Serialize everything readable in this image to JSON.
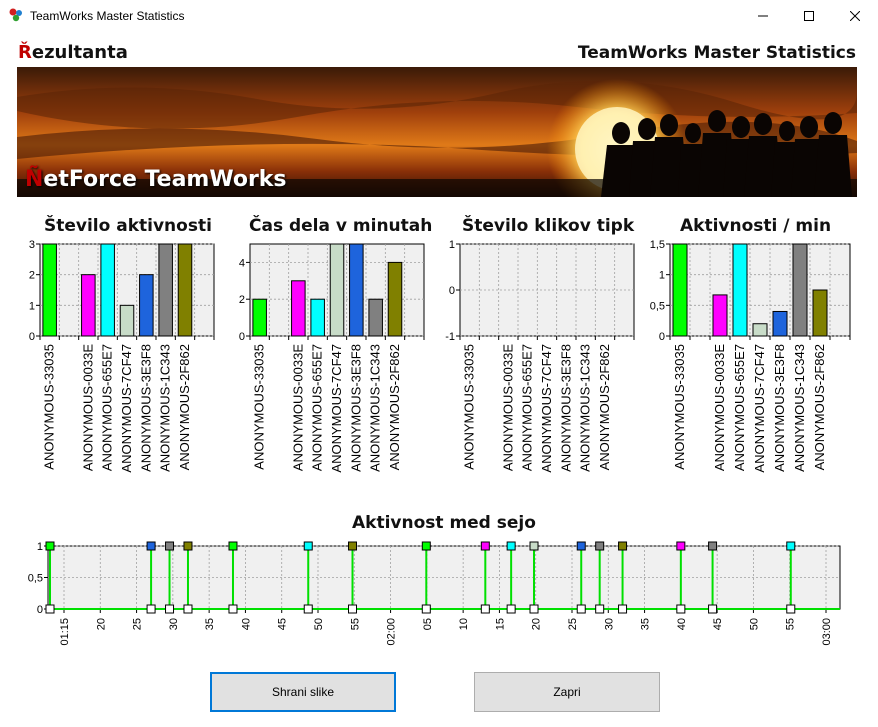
{
  "window": {
    "title": "TeamWorks Master Statistics",
    "buttons": [
      "minimize-icon",
      "maximize-icon",
      "close-icon"
    ]
  },
  "header": {
    "left_accent": "Ř",
    "left_rest": "ezultanta",
    "right": "TeamWorks Master Statistics"
  },
  "banner": {
    "logo_accent": "Ñ",
    "logo_rest": "etForce TeamWorks"
  },
  "categories": [
    "ANONYMOUS-33035",
    "ANONYMOUS-0033E",
    "ANONYMOUS-655E7",
    "ANONYMOUS-7CF47",
    "ANONYMOUS-3E3F8",
    "ANONYMOUS-1C343",
    "ANONYMOUS-2F862"
  ],
  "category_slots": [
    0,
    2,
    3,
    4,
    5,
    6,
    7
  ],
  "colors": [
    "#00ff00",
    "#ff00ff",
    "#00ffff",
    "#c8dcc8",
    "#1e64dc",
    "#808080",
    "#808000"
  ],
  "chart_data": [
    {
      "type": "bar",
      "title": "Število aktivnosti",
      "categories": [
        "ANONYMOUS-33035",
        "ANONYMOUS-0033E",
        "ANONYMOUS-655E7",
        "ANONYMOUS-7CF47",
        "ANONYMOUS-3E3F8",
        "ANONYMOUS-1C343",
        "ANONYMOUS-2F862"
      ],
      "values": [
        3,
        2,
        3,
        1,
        2,
        3,
        3
      ],
      "ylim": [
        0,
        3
      ],
      "yticks": [
        0,
        1,
        2,
        3
      ],
      "ytick_labels": [
        "0",
        "1",
        "2",
        "3"
      ],
      "grid": true
    },
    {
      "type": "bar",
      "title": "Čas dela v minutah",
      "categories": [
        "ANONYMOUS-33035",
        "ANONYMOUS-0033E",
        "ANONYMOUS-655E7",
        "ANONYMOUS-7CF47",
        "ANONYMOUS-3E3F8",
        "ANONYMOUS-1C343",
        "ANONYMOUS-2F862"
      ],
      "values": [
        2,
        3,
        2,
        5,
        5,
        2,
        4
      ],
      "ylim": [
        0,
        5
      ],
      "yticks": [
        0,
        2,
        4
      ],
      "ytick_labels": [
        "0",
        "2",
        "4"
      ],
      "grid": true
    },
    {
      "type": "bar",
      "title": "Število klikov tipk",
      "categories": [
        "ANONYMOUS-33035",
        "ANONYMOUS-0033E",
        "ANONYMOUS-655E7",
        "ANONYMOUS-7CF47",
        "ANONYMOUS-3E3F8",
        "ANONYMOUS-1C343",
        "ANONYMOUS-2F862"
      ],
      "values": [
        0,
        0,
        0,
        0,
        0,
        0,
        0
      ],
      "ylim": [
        -1,
        1
      ],
      "yticks": [
        -1,
        0,
        1
      ],
      "ytick_labels": [
        "-1",
        "0",
        "1"
      ],
      "grid": true
    },
    {
      "type": "bar",
      "title": "Aktivnosti / min",
      "categories": [
        "ANONYMOUS-33035",
        "ANONYMOUS-0033E",
        "ANONYMOUS-655E7",
        "ANONYMOUS-7CF47",
        "ANONYMOUS-3E3F8",
        "ANONYMOUS-1C343",
        "ANONYMOUS-2F862"
      ],
      "values": [
        1.5,
        0.67,
        1.5,
        0.2,
        0.4,
        1.5,
        0.75
      ],
      "ylim": [
        0,
        1.5
      ],
      "yticks": [
        0,
        0.5,
        1,
        1.5
      ],
      "ytick_labels": [
        "0",
        "0,5",
        "1",
        "1,5"
      ],
      "grid": true
    },
    {
      "type": "line",
      "title": "Aktivnost med sejo",
      "xlim": [
        1.0,
        106.8
      ],
      "ylim": [
        0,
        1
      ],
      "yticks": [
        0,
        0.5,
        1
      ],
      "ytick_labels": [
        "0",
        "0,5",
        "1"
      ],
      "xticks": [
        15,
        20,
        25,
        30,
        35,
        40,
        45,
        50,
        55,
        60,
        65,
        70,
        75,
        80,
        85,
        90,
        95,
        100,
        105
      ],
      "xtick_labels": [
        "01:15",
        "20",
        "25",
        "30",
        "35",
        "40",
        "45",
        "50",
        "55",
        "02:00",
        "05",
        "10",
        "15",
        "20",
        "25",
        "30",
        "35",
        "40",
        "45",
        "50",
        "55",
        "03:00"
      ],
      "events": [
        {
          "t": 0,
          "who": 0
        },
        {
          "t": 13.7,
          "who": 4
        },
        {
          "t": 16.2,
          "who": 5
        },
        {
          "t": 18.7,
          "who": 6
        },
        {
          "t": 24.8,
          "who": 0
        },
        {
          "t": 35.0,
          "who": 2
        },
        {
          "t": 41.0,
          "who": 6
        },
        {
          "t": 51.0,
          "who": 0
        },
        {
          "t": 59.0,
          "who": 1
        },
        {
          "t": 62.5,
          "who": 2
        },
        {
          "t": 65.6,
          "who": 3
        },
        {
          "t": 72.0,
          "who": 4
        },
        {
          "t": 74.5,
          "who": 5
        },
        {
          "t": 77.6,
          "who": 6
        },
        {
          "t": 85.5,
          "who": 1
        },
        {
          "t": 89.8,
          "who": 5
        },
        {
          "t": 100.4,
          "who": 2
        }
      ],
      "grid": true
    }
  ],
  "buttons": {
    "save_label": "Shrani slike",
    "close_label": "Zapri"
  }
}
